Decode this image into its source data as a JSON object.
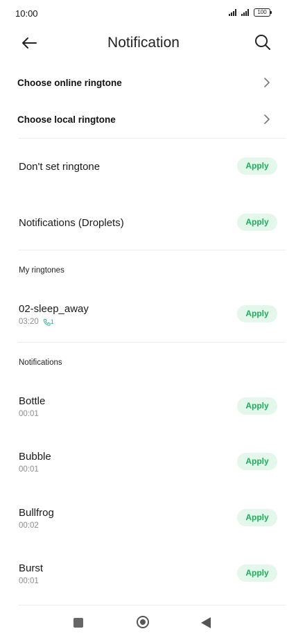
{
  "status_bar": {
    "time": "10:00",
    "battery": "100"
  },
  "header": {
    "title": "Notification"
  },
  "nav_rows": [
    {
      "label": "Choose online ringtone"
    },
    {
      "label": "Choose local ringtone"
    }
  ],
  "options": [
    {
      "name": "Don't set ringtone",
      "action": "Apply"
    },
    {
      "name": "Notifications (Droplets)",
      "action": "Apply"
    }
  ],
  "my_ringtones": {
    "heading": "My ringtones",
    "items": [
      {
        "name": "02-sleep_away",
        "duration": "03:20",
        "badge": "1",
        "action": "Apply"
      }
    ]
  },
  "notifications": {
    "heading": "Notifications",
    "items": [
      {
        "name": "Bottle",
        "duration": "00:01",
        "action": "Apply"
      },
      {
        "name": "Bubble",
        "duration": "00:01",
        "action": "Apply"
      },
      {
        "name": "Bullfrog",
        "duration": "00:02",
        "action": "Apply"
      },
      {
        "name": "Burst",
        "duration": "00:01",
        "action": "Apply"
      }
    ]
  },
  "colors": {
    "accent": "#1dae5c",
    "accent_bg": "#e3f7ea",
    "ringtone_icon": "#2bb5a0"
  }
}
